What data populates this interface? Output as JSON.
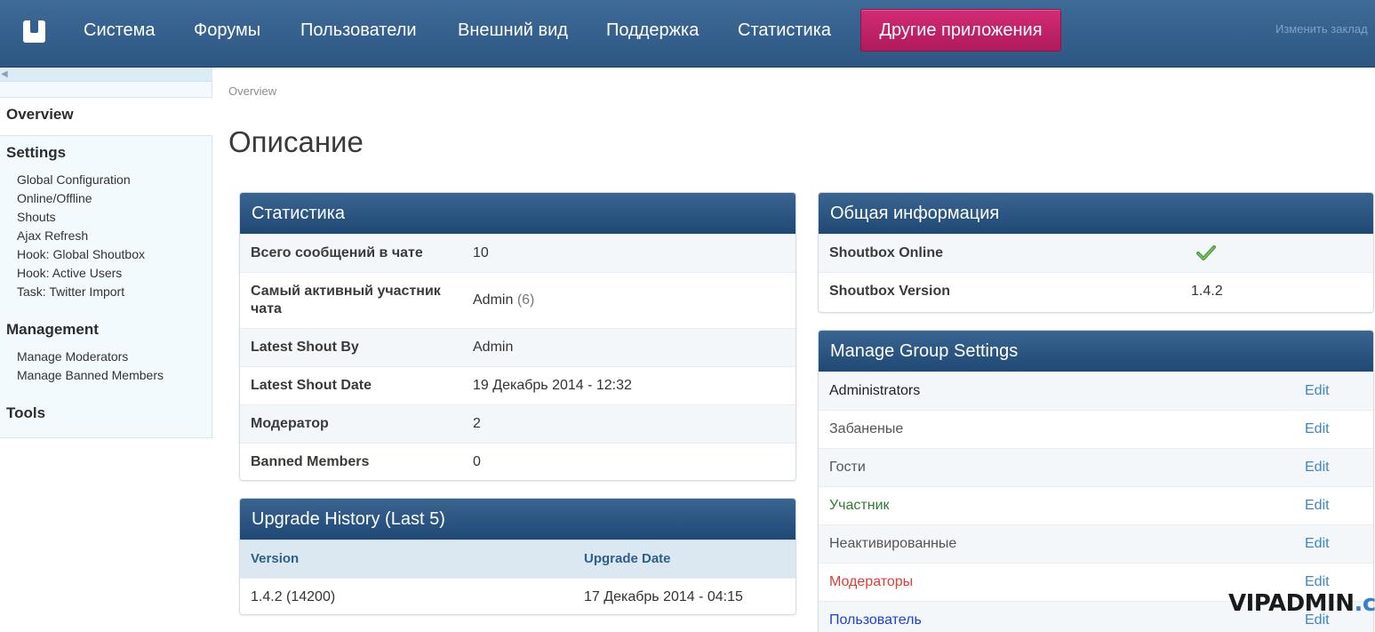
{
  "nav": {
    "items": [
      "Система",
      "Форумы",
      "Пользователи",
      "Внешний вид",
      "Поддержка",
      "Статистика"
    ],
    "apps_label": "Другие приложения",
    "bookmark_label": "Изменить заклад"
  },
  "sidebar": {
    "overview": "Overview",
    "settings_heading": "Settings",
    "settings_links": [
      "Global Configuration",
      "Online/Offline",
      "Shouts",
      "Ajax Refresh",
      "Hook: Global Shoutbox",
      "Hook: Active Users",
      "Task: Twitter Import"
    ],
    "management_heading": "Management",
    "management_links": [
      "Manage Moderators",
      "Manage Banned Members"
    ],
    "tools_heading": "Tools"
  },
  "breadcrumb": "Overview",
  "page_title": "Описание",
  "stats": {
    "title": "Статистика",
    "rows": [
      {
        "label": "Всего сообщений в чате",
        "value": "10"
      },
      {
        "label": "Самый активный участник чата",
        "value": "Admin",
        "extra": "(6)"
      },
      {
        "label": "Latest Shout By",
        "value": "Admin"
      },
      {
        "label": "Latest Shout Date",
        "value": "19 Декабрь 2014 - 12:32"
      },
      {
        "label": "Модератор",
        "value": "2"
      },
      {
        "label": "Banned Members",
        "value": "0"
      }
    ]
  },
  "upgrade": {
    "title": "Upgrade History (Last 5)",
    "col_version": "Version",
    "col_date": "Upgrade Date",
    "rows": [
      {
        "version": "1.4.2 (14200)",
        "date": "17 Декабрь 2014 - 04:15"
      }
    ]
  },
  "info": {
    "title": "Общая информация",
    "online_label": "Shoutbox Online",
    "online_status_icon": "check-icon",
    "version_label": "Shoutbox Version",
    "version_value": "1.4.2"
  },
  "groups": {
    "title": "Manage Group Settings",
    "edit_label": "Edit",
    "rows": [
      {
        "name": "Administrators",
        "color": "#222222"
      },
      {
        "name": "Забаненые",
        "color": "#555555"
      },
      {
        "name": "Гости",
        "color": "#555555"
      },
      {
        "name": "Участник",
        "color": "#2e7d32"
      },
      {
        "name": "Неактивированные",
        "color": "#555555"
      },
      {
        "name": "Модераторы",
        "color": "#e53935"
      },
      {
        "name": "Пользователь",
        "color": "#1e40d8"
      }
    ]
  },
  "watermark": {
    "part1": "VIPADMIN",
    "part2": ".club"
  }
}
